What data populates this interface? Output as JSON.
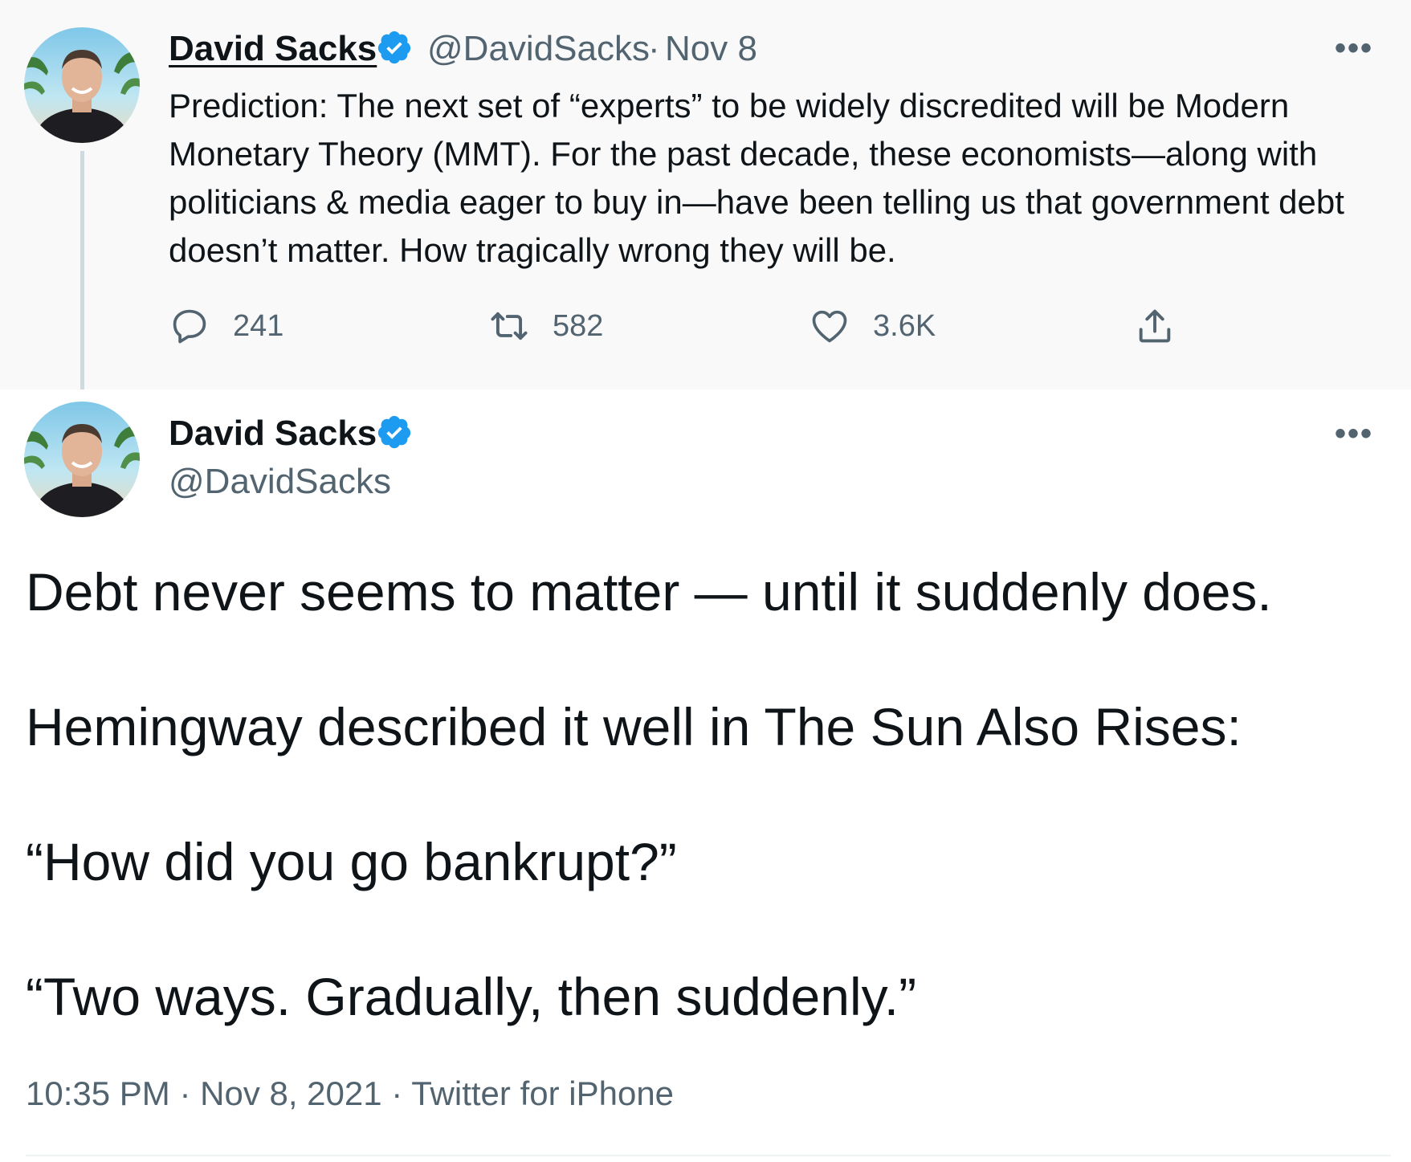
{
  "parent_tweet": {
    "author_name": "David Sacks",
    "handle": "@DavidSacks",
    "separator": "·",
    "date": "Nov 8",
    "more": "•••",
    "text": "Prediction: The next set of “experts” to be widely discredited will be Modern Monetary Theory (MMT). For the past decade, these economists—along with politicians & media eager to buy in—have been telling us that government debt doesn’t matter. How tragically wrong they will be.",
    "actions": {
      "reply_count": "241",
      "retweet_count": "582",
      "like_count": "3.6K"
    }
  },
  "main_tweet": {
    "author_name": "David Sacks",
    "handle": "@DavidSacks",
    "more": "•••",
    "paragraphs": [
      "Debt never seems to matter — until it suddenly does.",
      "Hemingway described it well in The Sun Also Rises:",
      "“How did you go bankrupt?”",
      "“Two ways. Gradually, then suddenly.”"
    ],
    "time": "10:35 PM",
    "date": "Nov 8, 2021",
    "source": "Twitter for iPhone",
    "separator": "·"
  },
  "colors": {
    "text": "#0f1419",
    "secondary": "#536471",
    "verified": "#1d9bf0",
    "thread_line": "#cfd9de"
  },
  "icons": [
    "verified-badge-icon",
    "more-icon",
    "reply-icon",
    "retweet-icon",
    "like-icon",
    "share-icon"
  ]
}
